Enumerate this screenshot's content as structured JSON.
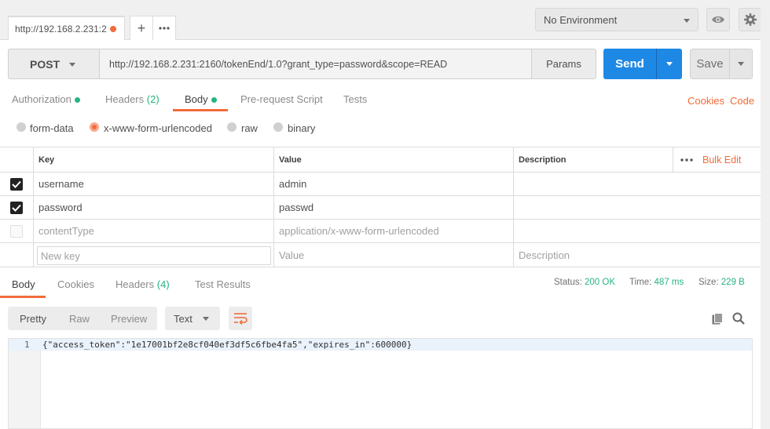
{
  "tab": {
    "title": "http://192.168.2.231:2"
  },
  "environment": {
    "selected": "No Environment"
  },
  "request": {
    "method": "POST",
    "url": "http://192.168.2.231:2160/tokenEnd/1.0?grant_type=password&scope=READ",
    "params_label": "Params",
    "send_label": "Send",
    "save_label": "Save"
  },
  "req_tabs": {
    "authorization": "Authorization",
    "headers": "Headers",
    "headers_count": "(2)",
    "body": "Body",
    "prerequest": "Pre-request Script",
    "tests": "Tests",
    "cookies": "Cookies",
    "code": "Code"
  },
  "body_types": {
    "form_data": "form-data",
    "urlencoded": "x-www-form-urlencoded",
    "raw": "raw",
    "binary": "binary",
    "selected": "x-www-form-urlencoded"
  },
  "kv_table": {
    "headers": {
      "key": "Key",
      "value": "Value",
      "description": "Description",
      "bulk_edit": "Bulk Edit"
    },
    "rows": [
      {
        "key": "username",
        "value": "admin",
        "checked": true
      },
      {
        "key": "password",
        "value": "passwd",
        "checked": true
      },
      {
        "key": "contentType",
        "value": "application/x-www-form-urlencoded",
        "checked": false
      }
    ],
    "new_row": {
      "key_placeholder": "New key",
      "value_placeholder": "Value",
      "description_placeholder": "Description"
    }
  },
  "response": {
    "tabs": {
      "body": "Body",
      "cookies": "Cookies",
      "headers": "Headers",
      "headers_count": "(4)",
      "test_results": "Test Results"
    },
    "status_label": "Status:",
    "status_value": "200 OK",
    "time_label": "Time:",
    "time_value": "487 ms",
    "size_label": "Size:",
    "size_value": "229 B",
    "format": {
      "pretty": "Pretty",
      "raw": "Raw",
      "preview": "Preview",
      "type": "Text"
    },
    "lines": [
      {
        "num": "1",
        "text": "{\"access_token\":\"1e17001bf2e8cf040ef3df5c6fbe4fa5\",\"expires_in\":600000}"
      }
    ]
  },
  "colors": {
    "accent": "#f26b3a",
    "send": "#1e88e5",
    "success": "#26b47f"
  }
}
